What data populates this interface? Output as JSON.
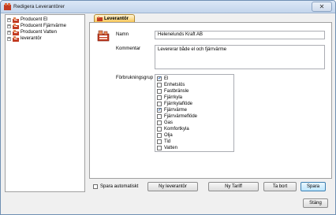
{
  "window": {
    "title": "Redigera Leverantörer",
    "close_glyph": "✕"
  },
  "tree": {
    "items": [
      {
        "label": "Producent El",
        "icon": "supplier-folder-icon"
      },
      {
        "label": "Producent Fjärrvärme",
        "icon": "supplier-folder-icon"
      },
      {
        "label": "Producent Vatten",
        "icon": "supplier-folder-icon"
      },
      {
        "label": "leverantör",
        "icon": "supplier-folder-icon"
      }
    ]
  },
  "tab": {
    "label": "Leverantör"
  },
  "form": {
    "name_label": "Namn",
    "name_value": "Helenelunds Kraft AB",
    "comment_label": "Kommentar",
    "comment_value": "Levererar både el och fjärrvärme",
    "groups_label": "Förbrukningsgrup",
    "groups": [
      {
        "label": "El",
        "checked": true
      },
      {
        "label": "Enhetslös",
        "checked": false
      },
      {
        "label": "Fastbränsle",
        "checked": false
      },
      {
        "label": "Fjärrkyla",
        "checked": false
      },
      {
        "label": "Fjärrkylaflöde",
        "checked": false
      },
      {
        "label": "Fjärrvärme",
        "checked": true
      },
      {
        "label": "Fjärrvärmeflöde",
        "checked": false
      },
      {
        "label": "Gas",
        "checked": false
      },
      {
        "label": "Komfortkyla",
        "checked": false
      },
      {
        "label": "Olja",
        "checked": false
      },
      {
        "label": "Tid",
        "checked": false
      },
      {
        "label": "Vatten",
        "checked": false
      }
    ]
  },
  "footer": {
    "autosave_label": "Spara automatiskt",
    "new_supplier": "Ny leverantör",
    "new_tariff": "Ny Tariff",
    "delete": "Ta bort",
    "save": "Spara",
    "close": "Stäng"
  }
}
